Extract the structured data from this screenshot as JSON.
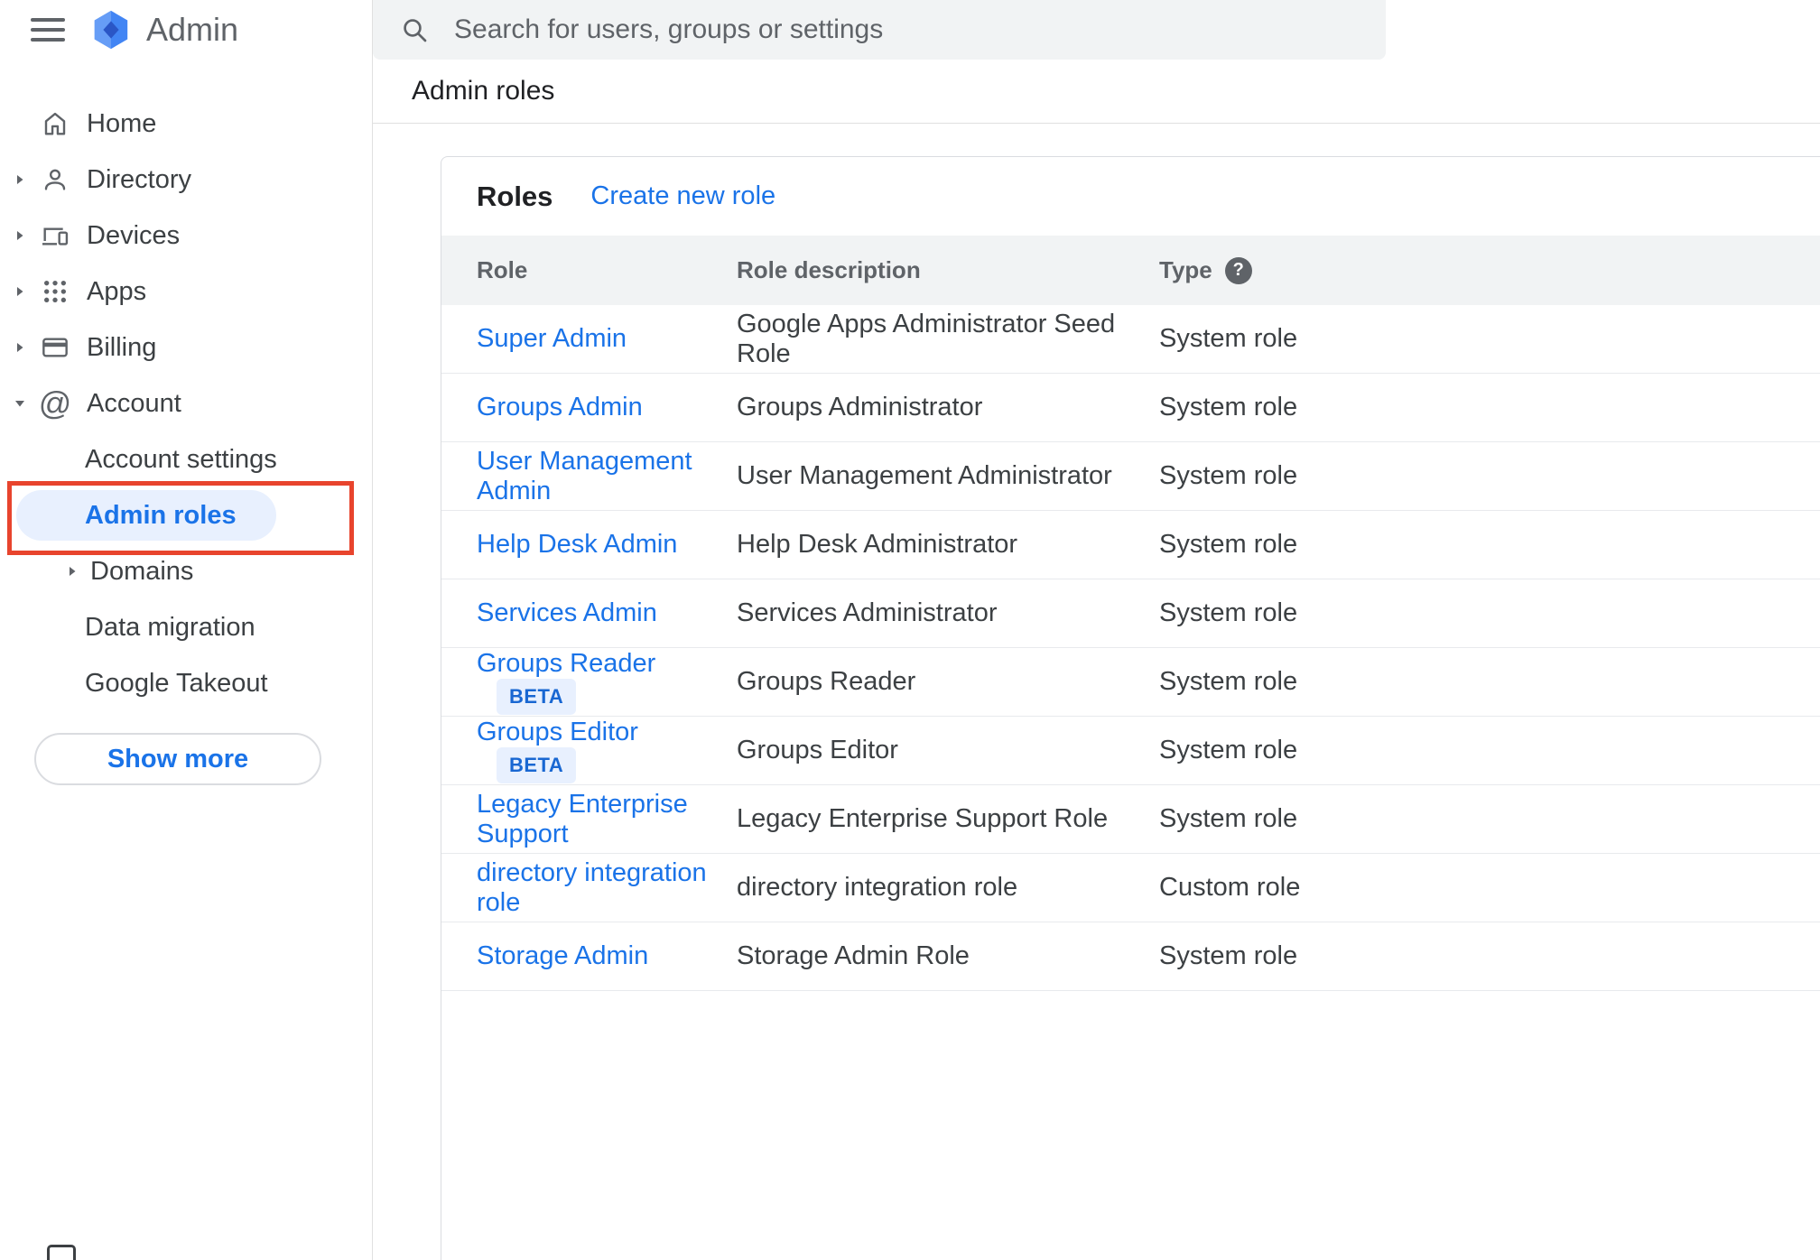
{
  "colors": {
    "link_blue": "#1a73e8",
    "selected_item_bg": "#e8f0fe",
    "beta_badge_bg": "#e8f0fe",
    "beta_badge_text": "#1967d2",
    "annotation_red": "#e8442d",
    "header_band_bg": "#f1f3f4",
    "searchbar_bg": "#f1f3f4"
  },
  "app": {
    "name": "Admin"
  },
  "search": {
    "placeholder": "Search for users, groups or settings"
  },
  "breadcrumb": {
    "label": "Admin roles"
  },
  "sidebar": {
    "items": [
      {
        "label": "Home"
      },
      {
        "label": "Directory"
      },
      {
        "label": "Devices"
      },
      {
        "label": "Apps"
      },
      {
        "label": "Billing"
      },
      {
        "label": "Account"
      }
    ],
    "account_subitems": [
      {
        "label": "Account settings"
      },
      {
        "label": "Admin roles",
        "selected": true
      },
      {
        "label": "Domains"
      },
      {
        "label": "Data migration"
      },
      {
        "label": "Google Takeout"
      }
    ],
    "show_more_label": "Show more"
  },
  "icons": {
    "help_glyph": "?",
    "at_glyph": "@"
  },
  "roles_card": {
    "title": "Roles",
    "create_link": "Create new role",
    "columns": [
      "Role",
      "Role description",
      "Type"
    ],
    "beta_label": "BETA",
    "rows": [
      {
        "role": "Super Admin",
        "description": "Google Apps Administrator Seed Role",
        "type": "System role"
      },
      {
        "role": "Groups Admin",
        "description": "Groups Administrator",
        "type": "System role"
      },
      {
        "role": "User Management Admin",
        "description": "User Management Administrator",
        "type": "System role"
      },
      {
        "role": "Help Desk Admin",
        "description": "Help Desk Administrator",
        "type": "System role"
      },
      {
        "role": "Services Admin",
        "description": "Services Administrator",
        "type": "System role"
      },
      {
        "role": "Groups Reader",
        "beta": true,
        "description": "Groups Reader",
        "type": "System role"
      },
      {
        "role": "Groups Editor",
        "beta": true,
        "description": "Groups Editor",
        "type": "System role"
      },
      {
        "role": "Legacy Enterprise Support",
        "description": "Legacy Enterprise Support Role",
        "type": "System role"
      },
      {
        "role": "directory integration role",
        "description": "directory integration role",
        "type": "Custom role"
      },
      {
        "role": "Storage Admin",
        "description": "Storage Admin Role",
        "type": "System role"
      }
    ]
  }
}
